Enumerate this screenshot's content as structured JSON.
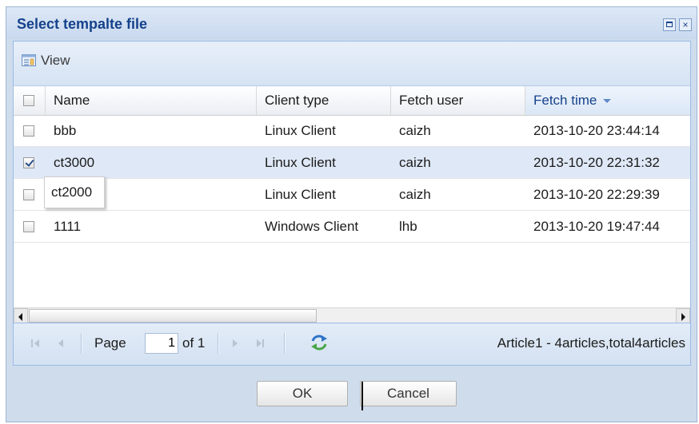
{
  "dialog": {
    "title": "Select tempalte file",
    "maximize_icon": "maximize-icon",
    "close_icon": "close-icon",
    "close_glyph": "×"
  },
  "toolbar": {
    "view_label": "View",
    "view_icon": "view-icon"
  },
  "grid": {
    "columns": [
      {
        "label": "Name"
      },
      {
        "label": "Client type"
      },
      {
        "label": "Fetch user"
      },
      {
        "label": "Fetch time",
        "sorted": "desc"
      }
    ],
    "rows": [
      {
        "name": "bbb",
        "client_type": "Linux Client",
        "fetch_user": "caizh",
        "fetch_time": "2013-10-20 23:44:14",
        "checked": false
      },
      {
        "name": "ct3000",
        "client_type": "Linux Client",
        "fetch_user": "caizh",
        "fetch_time": "2013-10-20 22:31:32",
        "checked": true
      },
      {
        "name": "ct2000",
        "client_type": "Linux Client",
        "fetch_user": "caizh",
        "fetch_time": "2013-10-20 22:29:39",
        "checked": false
      },
      {
        "name": "1111",
        "client_type": "Windows Client",
        "fetch_user": "lhb",
        "fetch_time": "2013-10-20 19:47:44",
        "checked": false
      }
    ]
  },
  "pager": {
    "page_label": "Page",
    "page_value": "1",
    "of_label": "of 1",
    "info": "Article1 - 4articles,total4articles",
    "refresh_icon": "refresh-icon"
  },
  "buttons": {
    "ok_label": "OK",
    "cancel_label": "Cancel"
  },
  "colors": {
    "title": "#15428b",
    "frame": "#cfdcec",
    "selected_row": "#dfe8f6"
  }
}
